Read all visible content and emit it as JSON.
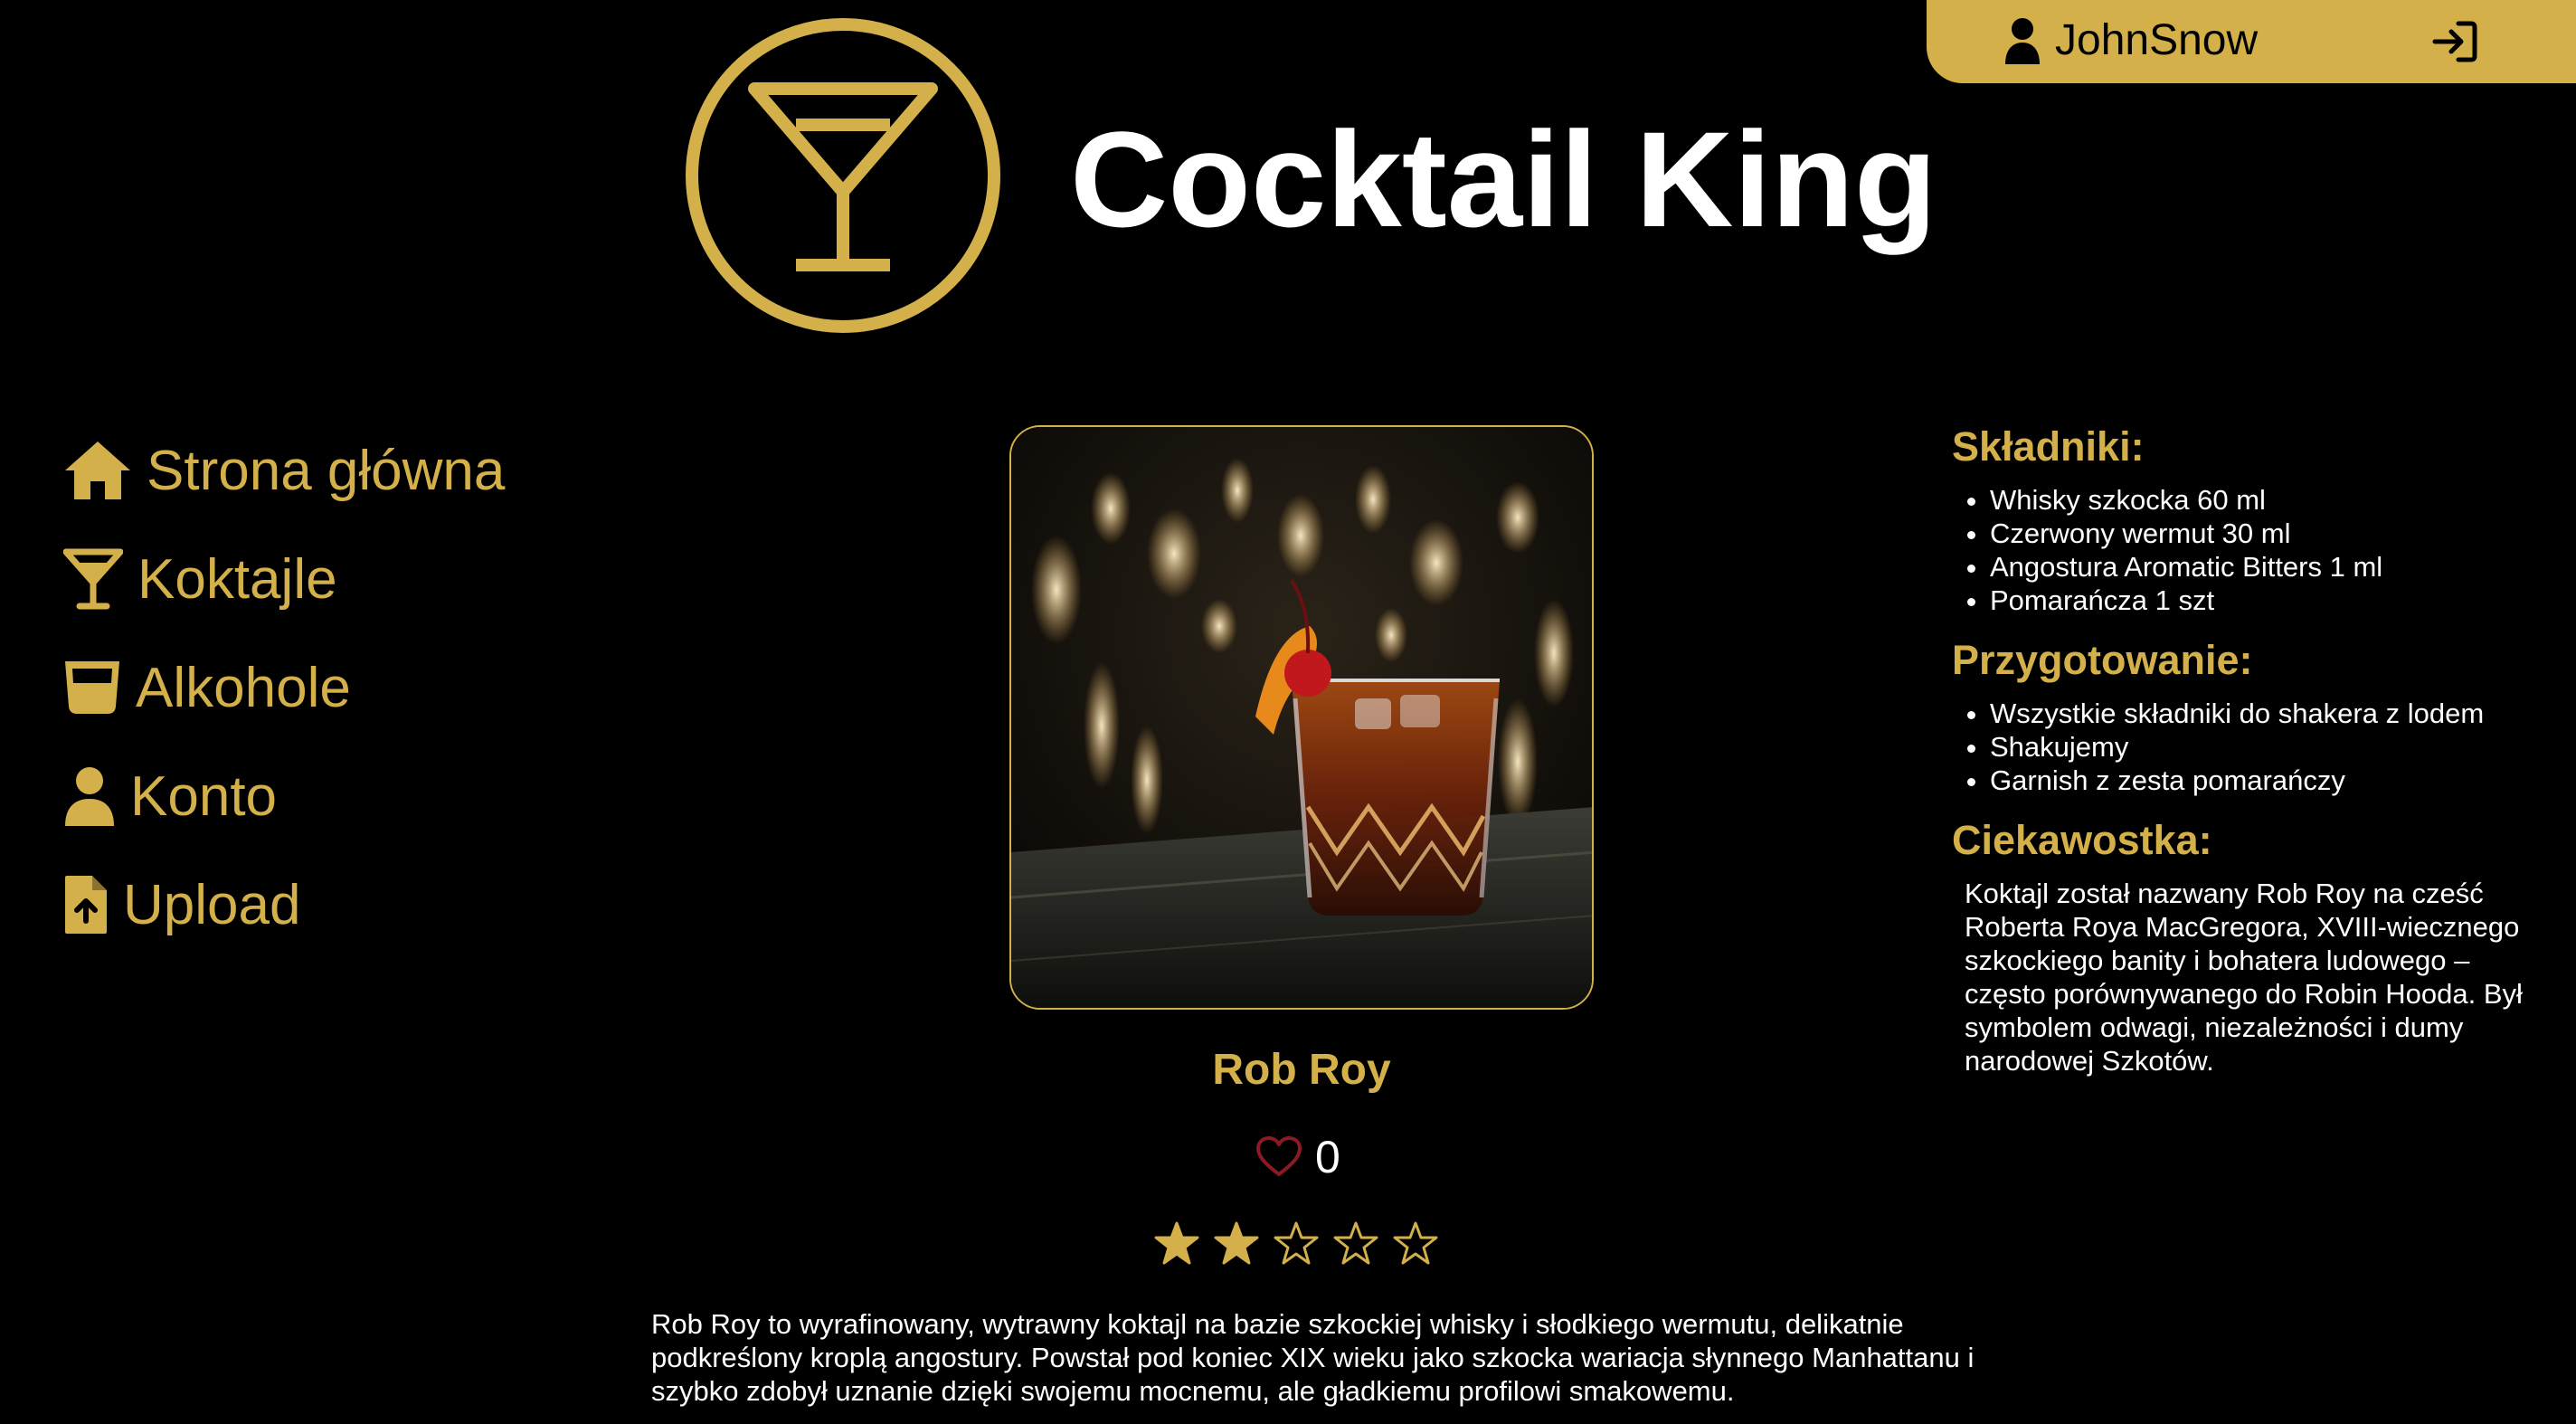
{
  "user": {
    "username": "JohnSnow",
    "user_icon": "user-icon",
    "logout_icon": "sign-in-icon"
  },
  "header": {
    "brand": "Cocktail King",
    "logo_icon": "martini-glass-circle-logo"
  },
  "nav": {
    "items": [
      {
        "label": "Strona główna",
        "icon": "home-icon"
      },
      {
        "label": "Koktajle",
        "icon": "martini-icon"
      },
      {
        "label": "Alkohole",
        "icon": "glass-icon"
      },
      {
        "label": "Konto",
        "icon": "user-icon"
      },
      {
        "label": "Upload",
        "icon": "file-upload-icon"
      }
    ]
  },
  "cocktail": {
    "name": "Rob Roy",
    "likes": "0",
    "rating": 2,
    "rating_max": 5,
    "description": "Rob Roy to wyrafinowany, wytrawny koktajl na bazie szkockiej whisky i słodkiego wermutu, delikatnie podkreślony kroplą angostury. Powstał pod koniec XIX wieku jako szkocka wariacja słynnego Manhattanu i szybko zdobył uznanie dzięki swojemu mocnemu, ale gładkiemu profilowi smakowemu."
  },
  "details": {
    "ingredients_title": "Składniki:",
    "ingredients": [
      "Whisky szkocka 60 ml",
      "Czerwony wermut 30 ml",
      "Angostura Aromatic Bitters 1 ml",
      "Pomarańcza 1 szt"
    ],
    "preparation_title": "Przygotowanie:",
    "preparation": [
      "Wszystkie składniki do shakera z lodem",
      "Shakujemy",
      "Garnish z zesta pomarańczy"
    ],
    "trivia_title": "Ciekawostka:",
    "trivia": "Koktajl został nazwany Rob Roy na cześć Roberta Roya MacGregora, XVIII-wiecznego szkockiego banity i bohatera ludowego – często porównywanego do Robin Hooda. Był symbolem odwagi, niezależności i dumy narodowej Szkotów."
  },
  "colors": {
    "accent": "#d4b04a",
    "background": "#000000",
    "heart": "#8b1a24"
  }
}
